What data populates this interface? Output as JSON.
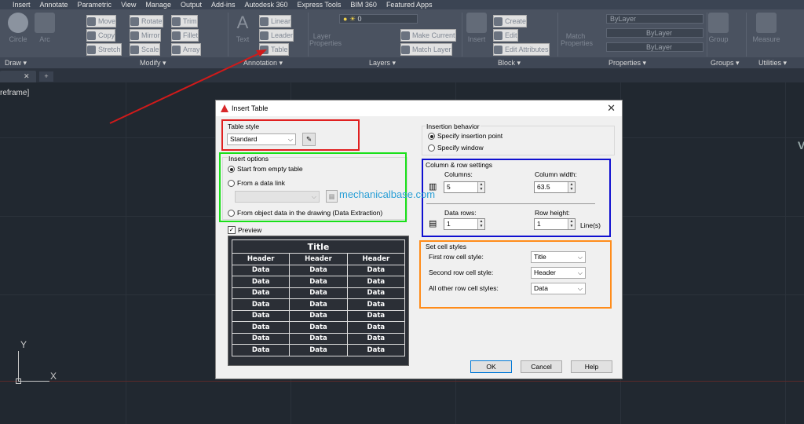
{
  "menu": [
    "Insert",
    "Annotate",
    "Parametric",
    "View",
    "Manage",
    "Output",
    "Add-ins",
    "Autodesk 360",
    "Express Tools",
    "BIM 360",
    "Featured Apps"
  ],
  "ribbon": {
    "draw": {
      "circle": "Circle",
      "arc": "Arc"
    },
    "modify": {
      "move": "Move",
      "rotate": "Rotate",
      "trim": "Trim",
      "copy": "Copy",
      "mirror": "Mirror",
      "fillet": "Fillet",
      "stretch": "Stretch",
      "scale": "Scale",
      "array": "Array"
    },
    "annotation": {
      "text": "Text",
      "linear": "Linear",
      "leader": "Leader",
      "table": "Table"
    },
    "layers": {
      "layer_properties": "Layer Properties",
      "make_current": "Make Current",
      "match_layer": "Match Layer",
      "layer_value": "0"
    },
    "block": {
      "insert": "Insert",
      "create": "Create",
      "edit": "Edit",
      "edit_attributes": "Edit Attributes"
    },
    "properties": {
      "match": "Match Properties",
      "bylayer1": "ByLayer",
      "bylayer2": "ByLayer",
      "bylayer3": "ByLayer"
    },
    "groups": {
      "group": "Group"
    },
    "utilities": {
      "measure": "Measure"
    },
    "panels": {
      "draw": "Draw ▾",
      "modify": "Modify ▾",
      "annotation": "Annotation ▾",
      "layers": "Layers ▾",
      "block": "Block ▾",
      "properties": "Properties ▾",
      "groups": "Groups ▾",
      "utilities": "Utilities ▾"
    }
  },
  "viewport_label": "reframe]",
  "ucs": {
    "x": "X",
    "y": "Y"
  },
  "right_edge_letter": "V",
  "watermark": "mechanicalbase.com",
  "dialog": {
    "title": "Insert Table",
    "table_style": {
      "label": "Table style",
      "value": "Standard"
    },
    "insert_options": {
      "label": "Insert options",
      "opt1": "Start from empty table",
      "opt2": "From a data link",
      "opt3": "From object data in the drawing (Data Extraction)"
    },
    "preview": {
      "label": "Preview",
      "title": "Title",
      "header": "Header",
      "data": "Data"
    },
    "insertion": {
      "label": "Insertion behavior",
      "opt1": "Specify insertion point",
      "opt2": "Specify window"
    },
    "colrow": {
      "label": "Column & row settings",
      "columns_label": "Columns:",
      "columns": "5",
      "colwidth_label": "Column width:",
      "colwidth": "63.5",
      "datarows_label": "Data rows:",
      "datarows": "1",
      "rowheight_label": "Row height:",
      "rowheight": "1",
      "lines_unit": "Line(s)"
    },
    "cellstyles": {
      "label": "Set cell styles",
      "first_label": "First row cell style:",
      "first": "Title",
      "second_label": "Second row cell style:",
      "second": "Header",
      "other_label": "All other row cell styles:",
      "other": "Data"
    },
    "buttons": {
      "ok": "OK",
      "cancel": "Cancel",
      "help": "Help"
    }
  },
  "colors": {
    "red_box": "#e02020",
    "green_box": "#19e019",
    "blue_box": "#1010d0",
    "orange_box": "#ff8c1a",
    "arrow": "#d01a1a"
  }
}
